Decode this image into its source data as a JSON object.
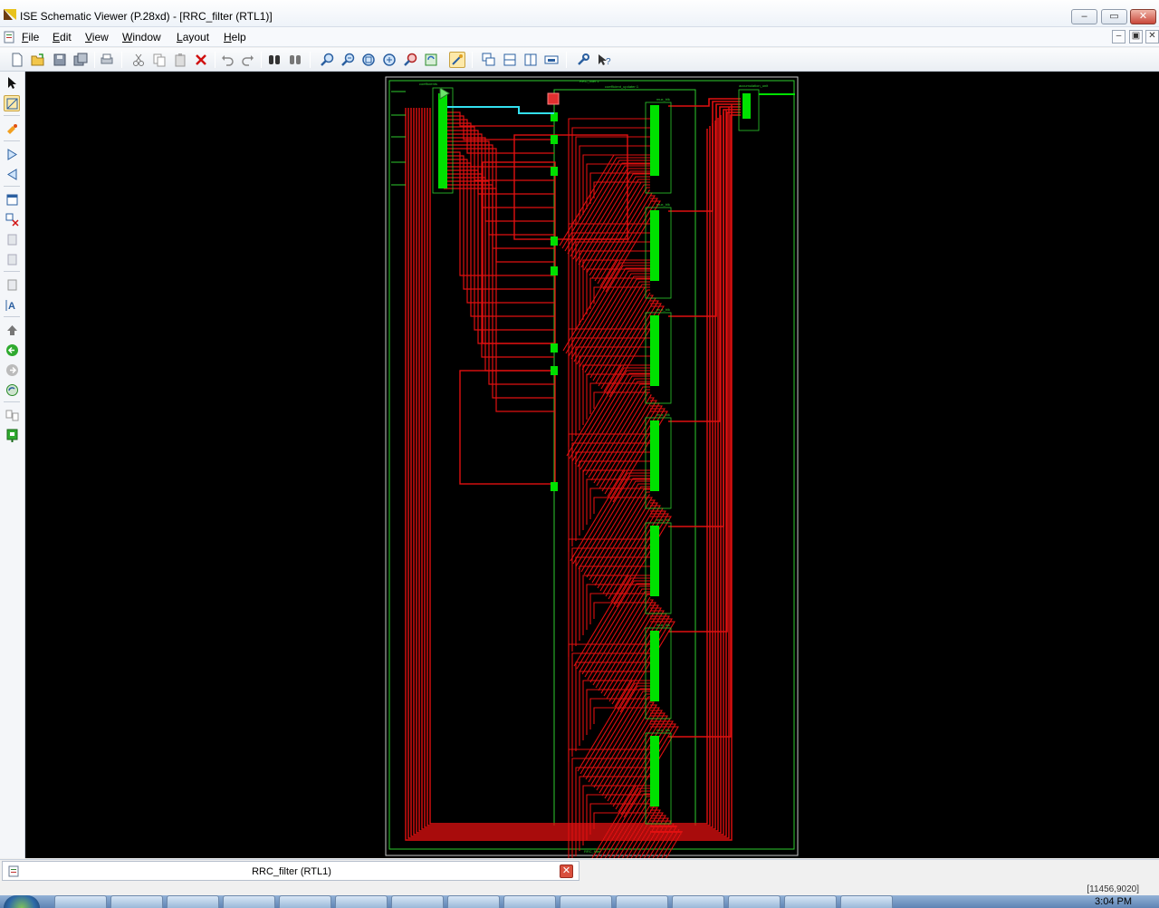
{
  "window": {
    "title": "ISE Schematic Viewer (P.28xd) - [RRC_filter (RTL1)]",
    "buttons": [
      "minimize",
      "maximize",
      "close"
    ]
  },
  "menu": {
    "items": [
      {
        "label": "File",
        "accel": "F",
        "rest": "ile"
      },
      {
        "label": "Edit",
        "accel": "E",
        "rest": "dit"
      },
      {
        "label": "View",
        "accel": "V",
        "rest": "iew"
      },
      {
        "label": "Window",
        "accel": "W",
        "rest": "indow"
      },
      {
        "label": "Layout",
        "accel": "L",
        "rest": "ayout"
      },
      {
        "label": "Help",
        "accel": "H",
        "rest": "elp"
      }
    ]
  },
  "toolbar": {
    "icons": [
      "new-icon",
      "open-icon",
      "save-icon",
      "save-all-icon",
      "print-icon",
      "cut-icon",
      "copy-icon",
      "paste-icon",
      "delete-icon",
      "undo-icon",
      "redo-icon",
      "find-icon",
      "find-next-icon",
      "zoom-in-icon",
      "zoom-out-icon",
      "zoom-full-icon",
      "zoom-area-icon",
      "zoom-select-icon",
      "refresh-icon",
      "pan-icon",
      "cascade-icon",
      "tile-horizontal-icon",
      "tile-vertical-icon",
      "arrange-icon",
      "properties-icon",
      "help-pointer-icon"
    ]
  },
  "lefttools": {
    "icons": [
      "select-icon",
      "zoom-to-box-icon",
      "highlight-icon",
      "add-input-icon",
      "add-output-icon",
      "expand-icon",
      "remove-icon",
      "push-icon",
      "pop-icon",
      "hierarchy-icon",
      "text-icon",
      "up-icon",
      "back-icon",
      "forward-icon",
      "refresh-view-icon",
      "copy-schematic-icon",
      "export-icon"
    ]
  },
  "schematic": {
    "top_label": "RRC_filter:1",
    "bottom_label": "RRC_filter",
    "inst_labels": [
      "coefficients",
      "coefficient_updater:1",
      "accumulation_unit",
      "mux_blk"
    ],
    "colors": {
      "background": "#000000",
      "wire": "#e01010",
      "block": "#00e000",
      "frame": "#2ecc2e",
      "selected": "#33e0f0"
    }
  },
  "tab": {
    "label": "RRC_filter (RTL1)"
  },
  "status": {
    "coords": "[11456,9020]"
  },
  "taskbar": {
    "clock": "3:04 PM"
  }
}
